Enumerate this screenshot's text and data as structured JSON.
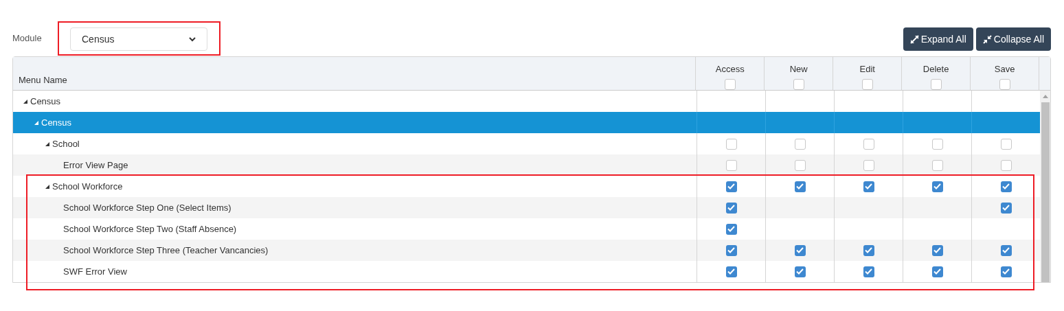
{
  "module": {
    "label": "Module",
    "value": "Census",
    "highlighted": true
  },
  "buttons": [
    {
      "kind": "expand",
      "label": "Expand All"
    },
    {
      "kind": "collapse",
      "label": "Collapse All"
    }
  ],
  "table": {
    "columns": [
      {
        "label": "Menu Name"
      },
      {
        "label": "Access",
        "checked": false
      },
      {
        "label": "New",
        "checked": false
      },
      {
        "label": "Edit",
        "checked": false
      },
      {
        "label": "Delete",
        "checked": false
      },
      {
        "label": "Save",
        "checked": false
      }
    ],
    "tree": [
      {
        "label": "Census",
        "expanded": true,
        "selected": false,
        "children": [
          {
            "label": "Census",
            "expanded": true,
            "selected": true,
            "children": [
              {
                "label": "School",
                "expanded": true,
                "selected": false,
                "permissions": [
                  {
                    "kind": "checkbox",
                    "checked": false
                  },
                  {
                    "kind": "checkbox",
                    "checked": false
                  },
                  {
                    "kind": "checkbox",
                    "checked": false
                  },
                  {
                    "kind": "checkbox",
                    "checked": false
                  },
                  {
                    "kind": "checkbox",
                    "checked": false
                  }
                ],
                "children": [
                  {
                    "label": "Error View Page",
                    "selected": false,
                    "permissions": [
                      {
                        "kind": "checkbox",
                        "checked": false
                      },
                      {
                        "kind": "checkbox",
                        "checked": false
                      },
                      {
                        "kind": "checkbox",
                        "checked": false
                      },
                      {
                        "kind": "checkbox",
                        "checked": false
                      },
                      {
                        "kind": "checkbox",
                        "checked": false
                      }
                    ]
                  }
                ]
              },
              {
                "label": "School Workforce",
                "expanded": true,
                "selected": false,
                "highlighted": true,
                "permissions": [
                  {
                    "kind": "checkbox",
                    "checked": true
                  },
                  {
                    "kind": "checkbox",
                    "checked": true
                  },
                  {
                    "kind": "checkbox",
                    "checked": true
                  },
                  {
                    "kind": "checkbox",
                    "checked": true
                  },
                  {
                    "kind": "checkbox",
                    "checked": true
                  }
                ],
                "children": [
                  {
                    "label": "School Workforce Step One (Select Items)",
                    "selected": false,
                    "permissions": [
                      {
                        "kind": "checkbox",
                        "checked": true
                      },
                      {
                        "kind": "empty"
                      },
                      {
                        "kind": "empty"
                      },
                      {
                        "kind": "empty"
                      },
                      {
                        "kind": "checkbox",
                        "checked": true
                      }
                    ]
                  },
                  {
                    "label": "School Workforce Step Two (Staff Absence)",
                    "selected": false,
                    "permissions": [
                      {
                        "kind": "checkbox",
                        "checked": true
                      },
                      {
                        "kind": "empty"
                      },
                      {
                        "kind": "empty"
                      },
                      {
                        "kind": "empty"
                      },
                      {
                        "kind": "empty"
                      }
                    ]
                  },
                  {
                    "label": "School Workforce Step Three (Teacher Vancancies)",
                    "selected": false,
                    "permissions": [
                      {
                        "kind": "checkbox",
                        "checked": true
                      },
                      {
                        "kind": "checkbox",
                        "checked": true
                      },
                      {
                        "kind": "checkbox",
                        "checked": true
                      },
                      {
                        "kind": "checkbox",
                        "checked": true
                      },
                      {
                        "kind": "checkbox",
                        "checked": true
                      }
                    ]
                  },
                  {
                    "label": "SWF Error View",
                    "selected": false,
                    "permissions": [
                      {
                        "kind": "checkbox",
                        "checked": true
                      },
                      {
                        "kind": "checkbox",
                        "checked": true
                      },
                      {
                        "kind": "checkbox",
                        "checked": true
                      },
                      {
                        "kind": "checkbox",
                        "checked": true
                      },
                      {
                        "kind": "checkbox",
                        "checked": true
                      }
                    ]
                  }
                ]
              }
            ]
          }
        ]
      }
    ]
  }
}
